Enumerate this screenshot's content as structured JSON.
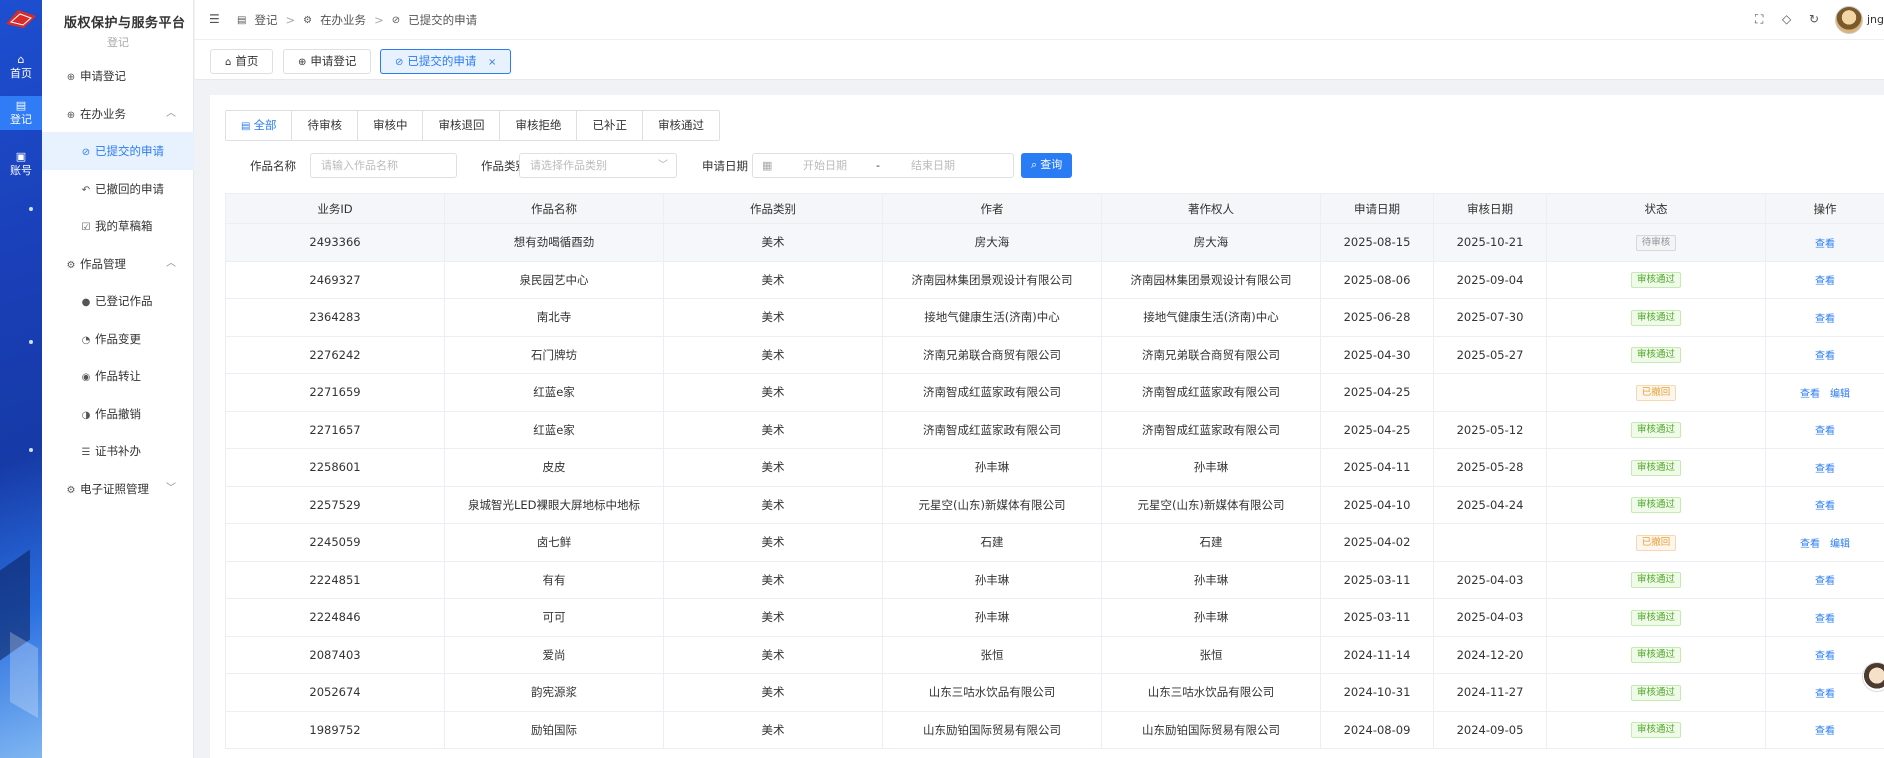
{
  "platform": {
    "title": "版权保护与服务平台",
    "subtitle": "登记"
  },
  "rail": {
    "items": [
      {
        "label": "首页",
        "icon": "home-icon"
      },
      {
        "label": "登记",
        "icon": "register-icon"
      },
      {
        "label": "账号",
        "icon": "account-icon"
      }
    ]
  },
  "sidebar": {
    "items": [
      {
        "label": "申请登记",
        "icon": "plus-circle-icon"
      },
      {
        "label": "在办业务",
        "icon": "plus-circle-icon"
      },
      {
        "label": "已提交的申请",
        "icon": "check-circle-icon"
      },
      {
        "label": "已撤回的申请",
        "icon": "undo-icon"
      },
      {
        "label": "我的草稿箱",
        "icon": "draft-icon"
      },
      {
        "label": "作品管理",
        "icon": "gear-icon"
      },
      {
        "label": "已登记作品",
        "icon": "registered-icon"
      },
      {
        "label": "作品变更",
        "icon": "change-icon"
      },
      {
        "label": "作品转让",
        "icon": "transfer-icon"
      },
      {
        "label": "作品撤销",
        "icon": "revoke-icon"
      },
      {
        "label": "证书补办",
        "icon": "certificate-icon"
      },
      {
        "label": "电子证照管理",
        "icon": "gear-icon"
      }
    ]
  },
  "breadcrumb": [
    "登记",
    "在办业务",
    "已提交的申请"
  ],
  "user": {
    "name": "jng"
  },
  "page_tabs": [
    {
      "label": "首页"
    },
    {
      "label": "申请登记"
    },
    {
      "label": "已提交的申请"
    }
  ],
  "status_tabs": [
    "全部",
    "待审核",
    "审核中",
    "审核退回",
    "审核拒绝",
    "已补正",
    "审核通过"
  ],
  "filters": {
    "name_label": "作品名称",
    "name_placeholder": "请输入作品名称",
    "type_label": "作品类别",
    "type_placeholder": "请选择作品类别",
    "date_label": "申请日期",
    "date_start_placeholder": "开始日期",
    "date_sep": "-",
    "date_end_placeholder": "结束日期",
    "search_label": "查询"
  },
  "table": {
    "headers": [
      "业务ID",
      "作品名称",
      "作品类别",
      "作者",
      "著作权人",
      "申请日期",
      "审核日期",
      "状态",
      "操作"
    ],
    "view_label": "查看",
    "edit_label": "编辑",
    "rows": [
      {
        "id": "2493366",
        "name": "想有劲喝循酉劲",
        "type": "美术",
        "author": "房大海",
        "owner": "房大海",
        "apply": "2025-08-15",
        "review": "2025-10-21",
        "status": "待审核",
        "status_kind": "pending",
        "edit": false
      },
      {
        "id": "2469327",
        "name": "泉民园艺中心",
        "type": "美术",
        "author": "济南园林集团景观设计有限公司",
        "owner": "济南园林集团景观设计有限公司",
        "apply": "2025-08-06",
        "review": "2025-09-04",
        "status": "审核通过",
        "status_kind": "approved",
        "edit": false
      },
      {
        "id": "2364283",
        "name": "南北寺",
        "type": "美术",
        "author": "接地气健康生活(济南)中心",
        "owner": "接地气健康生活(济南)中心",
        "apply": "2025-06-28",
        "review": "2025-07-30",
        "status": "审核通过",
        "status_kind": "approved",
        "edit": false
      },
      {
        "id": "2276242",
        "name": "石门牌坊",
        "type": "美术",
        "author": "济南兄弟联合商贸有限公司",
        "owner": "济南兄弟联合商贸有限公司",
        "apply": "2025-04-30",
        "review": "2025-05-27",
        "status": "审核通过",
        "status_kind": "approved",
        "edit": false
      },
      {
        "id": "2271659",
        "name": "红蓝e家",
        "type": "美术",
        "author": "济南智成红蓝家政有限公司",
        "owner": "济南智成红蓝家政有限公司",
        "apply": "2025-04-25",
        "review": "",
        "status": "已撤回",
        "status_kind": "withdrawn",
        "edit": true
      },
      {
        "id": "2271657",
        "name": "红蓝e家",
        "type": "美术",
        "author": "济南智成红蓝家政有限公司",
        "owner": "济南智成红蓝家政有限公司",
        "apply": "2025-04-25",
        "review": "2025-05-12",
        "status": "审核通过",
        "status_kind": "approved",
        "edit": false
      },
      {
        "id": "2258601",
        "name": "皮皮",
        "type": "美术",
        "author": "孙丰琳",
        "owner": "孙丰琳",
        "apply": "2025-04-11",
        "review": "2025-05-28",
        "status": "审核通过",
        "status_kind": "approved",
        "edit": false
      },
      {
        "id": "2257529",
        "name": "泉城智光LED裸眼大屏地标中地标",
        "type": "美术",
        "author": "元星空(山东)新媒体有限公司",
        "owner": "元星空(山东)新媒体有限公司",
        "apply": "2025-04-10",
        "review": "2025-04-24",
        "status": "审核通过",
        "status_kind": "approved",
        "edit": false
      },
      {
        "id": "2245059",
        "name": "卤七鲜",
        "type": "美术",
        "author": "石建",
        "owner": "石建",
        "apply": "2025-04-02",
        "review": "",
        "status": "已撤回",
        "status_kind": "withdrawn",
        "edit": true
      },
      {
        "id": "2224851",
        "name": "有有",
        "type": "美术",
        "author": "孙丰琳",
        "owner": "孙丰琳",
        "apply": "2025-03-11",
        "review": "2025-04-03",
        "status": "审核通过",
        "status_kind": "approved",
        "edit": false
      },
      {
        "id": "2224846",
        "name": "可可",
        "type": "美术",
        "author": "孙丰琳",
        "owner": "孙丰琳",
        "apply": "2025-03-11",
        "review": "2025-04-03",
        "status": "审核通过",
        "status_kind": "approved",
        "edit": false
      },
      {
        "id": "2087403",
        "name": "爱尚",
        "type": "美术",
        "author": "张恒",
        "owner": "张恒",
        "apply": "2024-11-14",
        "review": "2024-12-20",
        "status": "审核通过",
        "status_kind": "approved",
        "edit": false
      },
      {
        "id": "2052674",
        "name": "韵宪源浆",
        "type": "美术",
        "author": "山东三咕水饮品有限公司",
        "owner": "山东三咕水饮品有限公司",
        "apply": "2024-10-31",
        "review": "2024-11-27",
        "status": "审核通过",
        "status_kind": "approved",
        "edit": false
      },
      {
        "id": "1989752",
        "name": "励铂国际",
        "type": "美术",
        "author": "山东励铂国际贸易有限公司",
        "owner": "山东励铂国际贸易有限公司",
        "apply": "2024-08-09",
        "review": "2024-09-05",
        "status": "审核通过",
        "status_kind": "approved",
        "edit": false
      }
    ]
  },
  "colors": {
    "primary": "#2a7cf5",
    "rail": "#1d4fd0",
    "approved": "#52a82d",
    "withdrawn": "#e6a23c",
    "pending": "#909399"
  }
}
